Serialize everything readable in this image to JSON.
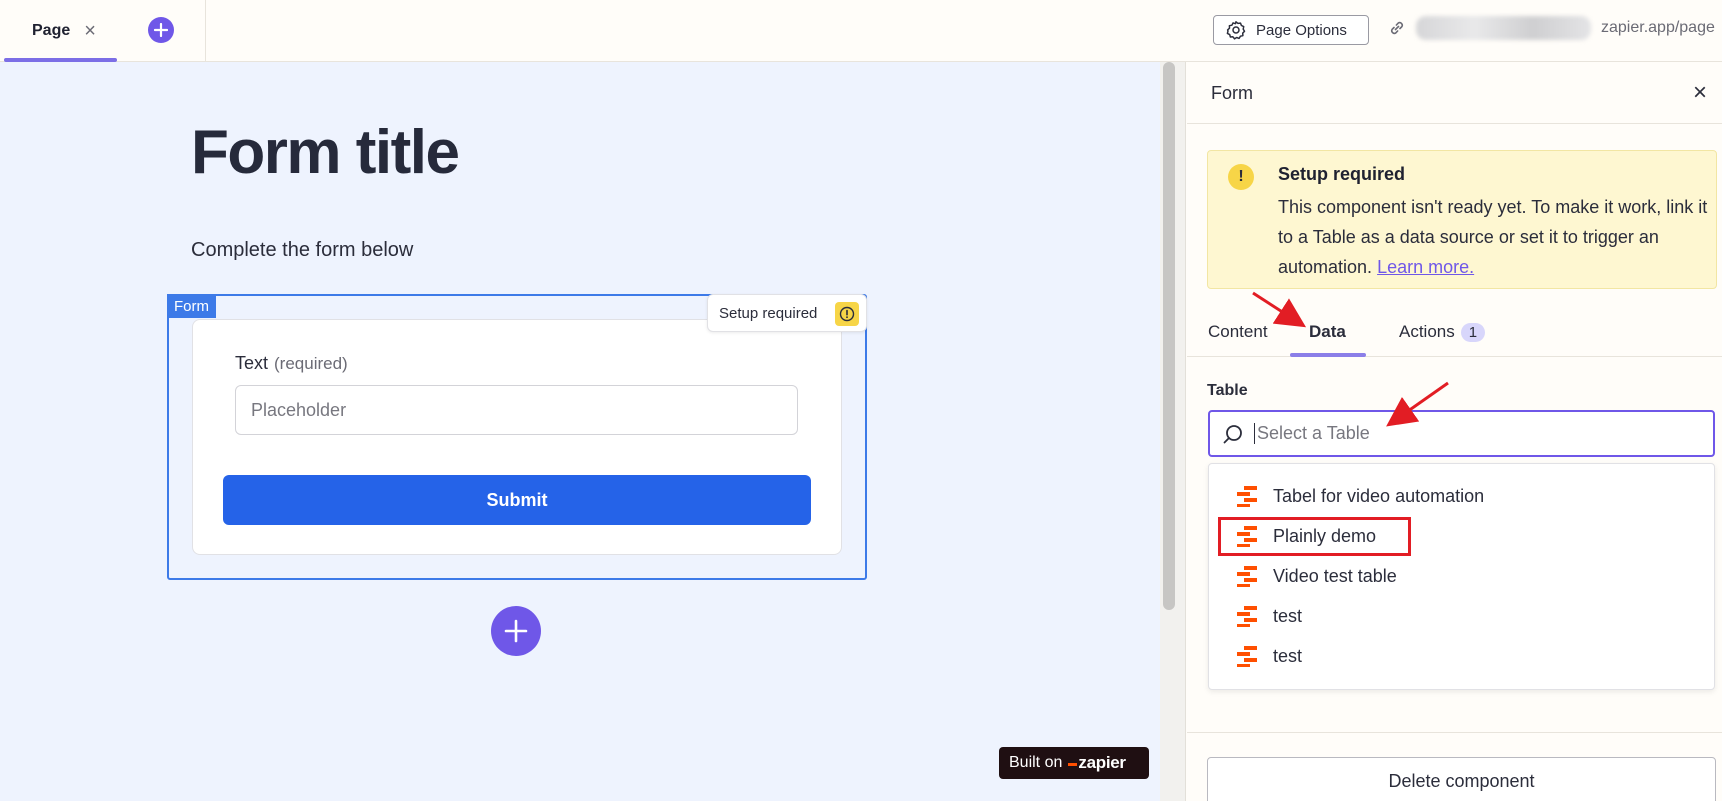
{
  "topbar": {
    "tab_label": "Page",
    "tab_close": "×",
    "page_options_label": "Page Options",
    "url_suffix": "zapier.app/page"
  },
  "canvas": {
    "title": "Form title",
    "subtitle": "Complete the form below",
    "form_tag": "Form",
    "setup_chip": "Setup required",
    "field_label": "Text",
    "field_required": "(required)",
    "field_placeholder": "Placeholder",
    "submit_label": "Submit",
    "built_on": "Built on",
    "zapier_logo": "zapier"
  },
  "panel": {
    "title": "Form",
    "close": "×",
    "alert": {
      "title": "Setup required",
      "body": "This component isn't ready yet. To make it work, link it to a Table as a data source or set it to trigger an automation.",
      "link": "Learn more."
    },
    "tabs": [
      {
        "label": "Content"
      },
      {
        "label": "Data"
      },
      {
        "label": "Actions",
        "badge": "1"
      }
    ],
    "table_label": "Table",
    "table_placeholder": "Select a Table",
    "tables": [
      {
        "label": "Tabel for video automation"
      },
      {
        "label": "Plainly demo"
      },
      {
        "label": "Video test table"
      },
      {
        "label": "test"
      },
      {
        "label": "test"
      }
    ],
    "delete_label": "Delete component"
  },
  "colors": {
    "accent": "#6f57e8",
    "form_blue": "#3d7ae8",
    "submit_blue": "#2563e8",
    "warning": "#f7d547",
    "table_icon": "#ff4f00",
    "annotation": "#e21d24"
  }
}
